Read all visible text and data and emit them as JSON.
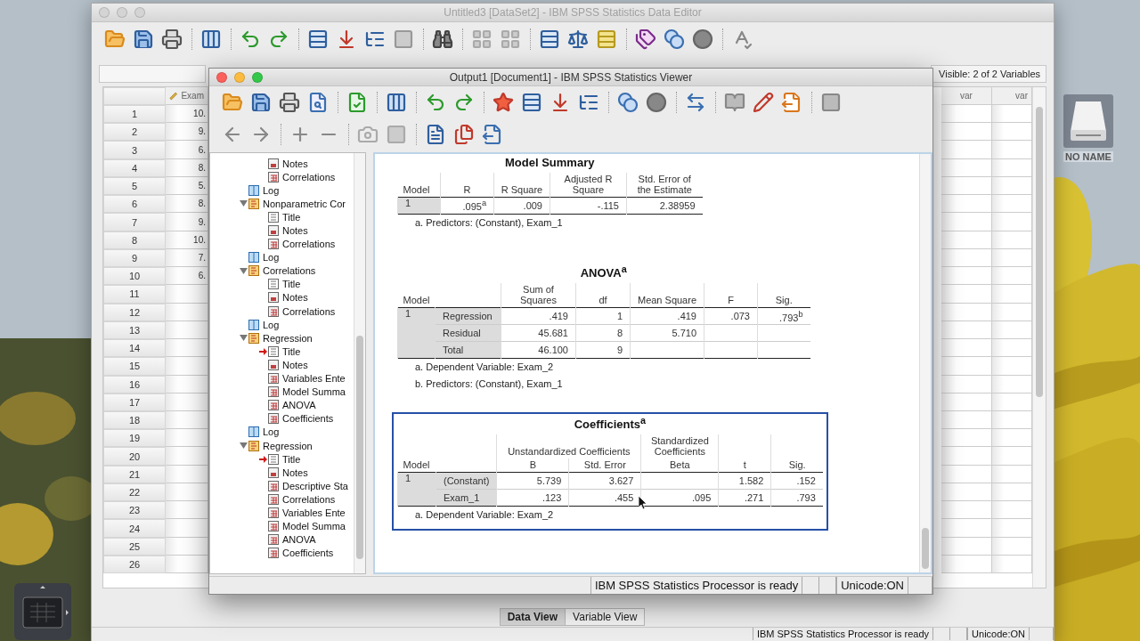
{
  "desktop": {
    "drive_label": "NO NAME"
  },
  "data_editor": {
    "title": "Untitled3 [DataSet2] - IBM SPSS Statistics Data Editor",
    "visible_info": "Visible: 2 of 2 Variables",
    "grid": {
      "first_column": "Exam",
      "empty_columns": [
        "var",
        "var"
      ],
      "rows": [
        {
          "number": "1",
          "value": "10."
        },
        {
          "number": "2",
          "value": "9."
        },
        {
          "number": "3",
          "value": "6."
        },
        {
          "number": "4",
          "value": "8."
        },
        {
          "number": "5",
          "value": "5."
        },
        {
          "number": "6",
          "value": "8."
        },
        {
          "number": "7",
          "value": "9."
        },
        {
          "number": "8",
          "value": "10."
        },
        {
          "number": "9",
          "value": "7."
        },
        {
          "number": "10",
          "value": "6."
        },
        {
          "number": "11"
        },
        {
          "number": "12"
        },
        {
          "number": "13"
        },
        {
          "number": "14"
        },
        {
          "number": "15"
        },
        {
          "number": "16"
        },
        {
          "number": "17"
        },
        {
          "number": "18"
        },
        {
          "number": "19"
        },
        {
          "number": "20"
        },
        {
          "number": "21"
        },
        {
          "number": "22"
        },
        {
          "number": "23"
        },
        {
          "number": "24"
        },
        {
          "number": "25"
        },
        {
          "number": "26"
        }
      ]
    },
    "view_tabs": [
      {
        "label": "Data View",
        "selected": true
      },
      {
        "label": "Variable View",
        "selected": false
      }
    ],
    "status_bar": [
      "IBM SPSS Statistics Processor is ready",
      "Unicode:ON"
    ]
  },
  "viewer": {
    "title": "Output1 [Document1] - IBM SPSS Statistics Viewer",
    "outline": [
      {
        "kind": "hidden",
        "children": [
          {
            "label": "Notes",
            "kind": "notes",
            "current": false
          },
          {
            "label": "Correlations",
            "kind": "table",
            "current": false
          }
        ]
      },
      {
        "label": "Log",
        "kind": "log"
      },
      {
        "label": "Nonparametric Cor",
        "kind": "procedure",
        "expanded": true,
        "children": [
          {
            "label": "Title",
            "kind": "title",
            "current": false
          },
          {
            "label": "Notes",
            "kind": "notes",
            "current": false
          },
          {
            "label": "Correlations",
            "kind": "table",
            "current": false
          }
        ]
      },
      {
        "label": "Log",
        "kind": "log"
      },
      {
        "label": "Correlations",
        "kind": "procedure",
        "expanded": true,
        "children": [
          {
            "label": "Title",
            "kind": "title",
            "current": false
          },
          {
            "label": "Notes",
            "kind": "notes",
            "current": false
          },
          {
            "label": "Correlations",
            "kind": "table",
            "current": false
          }
        ]
      },
      {
        "label": "Log",
        "kind": "log"
      },
      {
        "label": "Regression",
        "kind": "procedure",
        "expanded": true,
        "children": [
          {
            "label": "Title",
            "kind": "title",
            "current": true
          },
          {
            "label": "Notes",
            "kind": "notes",
            "current": false
          },
          {
            "label": "Variables Ente",
            "kind": "table",
            "current": false
          },
          {
            "label": "Model Summa",
            "kind": "table",
            "current": false
          },
          {
            "label": "ANOVA",
            "kind": "table",
            "current": false
          },
          {
            "label": "Coefficients",
            "kind": "table",
            "current": false
          }
        ]
      },
      {
        "label": "Log",
        "kind": "log"
      },
      {
        "label": "Regression",
        "kind": "procedure",
        "expanded": true,
        "children": [
          {
            "label": "Title",
            "kind": "title",
            "current": true
          },
          {
            "label": "Notes",
            "kind": "notes",
            "current": false
          },
          {
            "label": "Descriptive Sta",
            "kind": "table",
            "current": false
          },
          {
            "label": "Correlations",
            "kind": "table",
            "current": false
          },
          {
            "label": "Variables Ente",
            "kind": "table",
            "current": false
          },
          {
            "label": "Model Summa",
            "kind": "table",
            "current": false
          },
          {
            "label": "ANOVA",
            "kind": "table",
            "current": false
          },
          {
            "label": "Coefficients",
            "kind": "table",
            "current": false
          }
        ]
      }
    ],
    "tables": [
      {
        "title": "Model Summary",
        "selected": false,
        "model_header": "Model",
        "columns": [
          "R",
          "R Square",
          "Adjusted R Square",
          "Std. Error of the Estimate"
        ],
        "rows": [
          {
            "model": "1",
            "values": [
              ".095$^{a}$",
              ".009",
              "-.115",
              "2.38959"
            ]
          }
        ],
        "footnotes": [
          "a. Predictors: (Constant), Exam_1"
        ]
      },
      {
        "title": "ANOVA$^{a}$",
        "selected": false,
        "model_header": "Model",
        "columns": [
          "Sum of Squares",
          "df",
          "Mean Square",
          "F",
          "Sig."
        ],
        "rows": [
          {
            "model": "1",
            "label": "Regression",
            "values": [
              ".419",
              "1",
              ".419",
              ".073",
              ".793$^{b}$"
            ]
          },
          {
            "label": "Residual",
            "values": [
              "45.681",
              "8",
              "5.710"
            ]
          },
          {
            "label": "Total",
            "values": [
              "46.100",
              "9"
            ]
          }
        ],
        "footnotes": [
          "a. Dependent Variable: Exam_2",
          "b. Predictors: (Constant), Exam_1"
        ]
      },
      {
        "title": "Coefficients$^{a}$",
        "selected": true,
        "model_header": "Model",
        "groups": [
          {
            "label": "Unstandardized Coefficients",
            "columns": [
              "B",
              "Std. Error"
            ]
          },
          {
            "label": "Standardized Coefficients",
            "columns": [
              "Beta"
            ]
          },
          {
            "columns": [
              "t"
            ]
          },
          {
            "columns": [
              "Sig."
            ]
          }
        ],
        "rows": [
          {
            "model": "1",
            "label": "(Constant)",
            "value_groups": [
              [
                "5.739",
                "3.627"
              ],
              [
                "1.582",
                ".152"
              ]
            ]
          },
          {
            "label": "Exam_1",
            "values": [
              ".123",
              ".455",
              ".095",
              ".271",
              ".793"
            ]
          }
        ],
        "footnotes": [
          "a. Dependent Variable: Exam_2"
        ]
      }
    ],
    "status_bar": [
      "IBM SPSS Statistics Processor is ready",
      "Unicode:ON"
    ]
  }
}
